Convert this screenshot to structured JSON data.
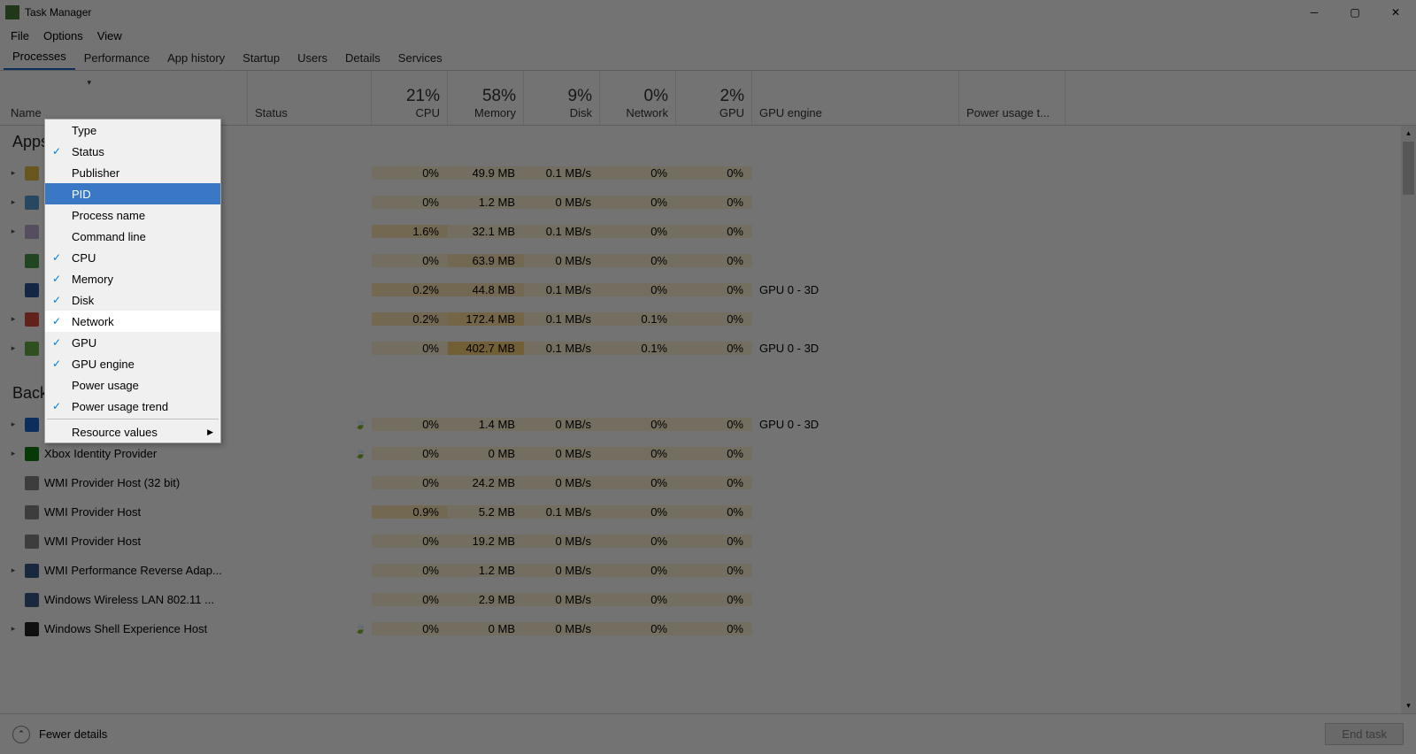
{
  "window": {
    "title": "Task Manager"
  },
  "menus": [
    "File",
    "Options",
    "View"
  ],
  "tabs": [
    "Processes",
    "Performance",
    "App history",
    "Startup",
    "Users",
    "Details",
    "Services"
  ],
  "active_tab": "Processes",
  "columns": {
    "name": "Name",
    "status": "Status",
    "cpu": {
      "pct": "21%",
      "lbl": "CPU"
    },
    "memory": {
      "pct": "58%",
      "lbl": "Memory"
    },
    "disk": {
      "pct": "9%",
      "lbl": "Disk"
    },
    "network": {
      "pct": "0%",
      "lbl": "Network"
    },
    "gpu": {
      "pct": "2%",
      "lbl": "GPU"
    },
    "gpu_engine": "GPU engine",
    "power": "Power usage t..."
  },
  "groups": {
    "apps": "Apps",
    "background": "Background"
  },
  "context_menu": [
    {
      "label": "Type",
      "checked": false
    },
    {
      "label": "Status",
      "checked": true
    },
    {
      "label": "Publisher",
      "checked": false
    },
    {
      "label": "PID",
      "checked": false,
      "selected": true
    },
    {
      "label": "Process name",
      "checked": false
    },
    {
      "label": "Command line",
      "checked": false
    },
    {
      "label": "CPU",
      "checked": true
    },
    {
      "label": "Memory",
      "checked": true
    },
    {
      "label": "Disk",
      "checked": true
    },
    {
      "label": "Network",
      "checked": true,
      "hover": true
    },
    {
      "label": "GPU",
      "checked": true
    },
    {
      "label": "GPU engine",
      "checked": true
    },
    {
      "label": "Power usage",
      "checked": false
    },
    {
      "label": "Power usage trend",
      "checked": true
    },
    {
      "separator": true
    },
    {
      "label": "Resource values",
      "submenu": true
    }
  ],
  "rows_apps": [
    {
      "name": "",
      "expand": true,
      "icon": "#e6c04a",
      "cpu": "0%",
      "mem": "49.9 MB",
      "disk": "0.1 MB/s",
      "net": "0%",
      "gpu": "0%",
      "gpue": "",
      "h": [
        "heat1",
        "heat1",
        "heat1",
        "heat1",
        "heat1"
      ]
    },
    {
      "name": "",
      "expand": true,
      "icon": "#5aa0d8",
      "cpu": "0%",
      "mem": "1.2 MB",
      "disk": "0 MB/s",
      "net": "0%",
      "gpu": "0%",
      "gpue": "",
      "h": [
        "heat1",
        "heat1",
        "heat1",
        "heat1",
        "heat1"
      ]
    },
    {
      "name": "",
      "expand": true,
      "icon": "#bfaed1",
      "cpu": "1.6%",
      "mem": "32.1 MB",
      "disk": "0.1 MB/s",
      "net": "0%",
      "gpu": "0%",
      "gpue": "",
      "h": [
        "heat2",
        "heat1",
        "heat1",
        "heat1",
        "heat1"
      ]
    },
    {
      "name": "",
      "expand": false,
      "icon": "#4a9a4a",
      "cpu": "0%",
      "mem": "63.9 MB",
      "disk": "0 MB/s",
      "net": "0%",
      "gpu": "0%",
      "gpue": "",
      "h": [
        "heat1",
        "heat2",
        "heat1",
        "heat1",
        "heat1"
      ]
    },
    {
      "name": "",
      "expand": false,
      "icon": "#2b579a",
      "cpu": "0.2%",
      "mem": "44.8 MB",
      "disk": "0.1 MB/s",
      "net": "0%",
      "gpu": "0%",
      "gpue": "GPU 0 - 3D",
      "h": [
        "heat2",
        "heat2",
        "heat1",
        "heat1",
        "heat1"
      ]
    },
    {
      "name": "",
      "expand": true,
      "icon": "#d94a3a",
      "cpu": "0.2%",
      "mem": "172.4 MB",
      "disk": "0.1 MB/s",
      "net": "0.1%",
      "gpu": "0%",
      "gpue": "",
      "h": [
        "heat2",
        "heat3",
        "heat1",
        "heat1",
        "heat1"
      ]
    },
    {
      "name": "",
      "expand": true,
      "icon": "#6ab04a",
      "cpu": "0%",
      "mem": "402.7 MB",
      "disk": "0.1 MB/s",
      "net": "0.1%",
      "gpu": "0%",
      "gpue": "GPU 0 - 3D",
      "h": [
        "heat1",
        "heat4",
        "heat1",
        "heat1",
        "heat1"
      ]
    }
  ],
  "rows_bg": [
    {
      "name": "",
      "expand": true,
      "icon": "#1a66c9",
      "suspend": true,
      "cpu": "0%",
      "mem": "1.4 MB",
      "disk": "0 MB/s",
      "net": "0%",
      "gpu": "0%",
      "gpue": "GPU 0 - 3D",
      "h": [
        "heat1",
        "heat1",
        "heat1",
        "heat1",
        "heat1"
      ]
    },
    {
      "name": "Xbox Identity Provider",
      "expand": true,
      "icon": "#107c10",
      "suspend": true,
      "cpu": "0%",
      "mem": "0 MB",
      "disk": "0 MB/s",
      "net": "0%",
      "gpu": "0%",
      "gpue": "",
      "h": [
        "heat1",
        "heat1",
        "heat1",
        "heat1",
        "heat1"
      ]
    },
    {
      "name": "WMI Provider Host (32 bit)",
      "expand": false,
      "icon": "#888",
      "cpu": "0%",
      "mem": "24.2 MB",
      "disk": "0 MB/s",
      "net": "0%",
      "gpu": "0%",
      "gpue": "",
      "h": [
        "heat1",
        "heat1",
        "heat1",
        "heat1",
        "heat1"
      ]
    },
    {
      "name": "WMI Provider Host",
      "expand": false,
      "icon": "#888",
      "cpu": "0.9%",
      "mem": "5.2 MB",
      "disk": "0.1 MB/s",
      "net": "0%",
      "gpu": "0%",
      "gpue": "",
      "h": [
        "heat2",
        "heat1",
        "heat1",
        "heat1",
        "heat1"
      ]
    },
    {
      "name": "WMI Provider Host",
      "expand": false,
      "icon": "#888",
      "cpu": "0%",
      "mem": "19.2 MB",
      "disk": "0 MB/s",
      "net": "0%",
      "gpu": "0%",
      "gpue": "",
      "h": [
        "heat1",
        "heat1",
        "heat1",
        "heat1",
        "heat1"
      ]
    },
    {
      "name": "WMI Performance Reverse Adap...",
      "expand": true,
      "icon": "#3a5a8a",
      "cpu": "0%",
      "mem": "1.2 MB",
      "disk": "0 MB/s",
      "net": "0%",
      "gpu": "0%",
      "gpue": "",
      "h": [
        "heat1",
        "heat1",
        "heat1",
        "heat1",
        "heat1"
      ]
    },
    {
      "name": "Windows Wireless LAN 802.11 ...",
      "expand": false,
      "icon": "#3a5a8a",
      "cpu": "0%",
      "mem": "2.9 MB",
      "disk": "0 MB/s",
      "net": "0%",
      "gpu": "0%",
      "gpue": "",
      "h": [
        "heat1",
        "heat1",
        "heat1",
        "heat1",
        "heat1"
      ]
    },
    {
      "name": "Windows Shell Experience Host",
      "expand": true,
      "icon": "#222",
      "suspend": true,
      "cpu": "0%",
      "mem": "0 MB",
      "disk": "0 MB/s",
      "net": "0%",
      "gpu": "0%",
      "gpue": "",
      "h": [
        "heat1",
        "heat1",
        "heat1",
        "heat1",
        "heat1"
      ]
    }
  ],
  "footer": {
    "fewer": "Fewer details",
    "end_task": "End task"
  }
}
